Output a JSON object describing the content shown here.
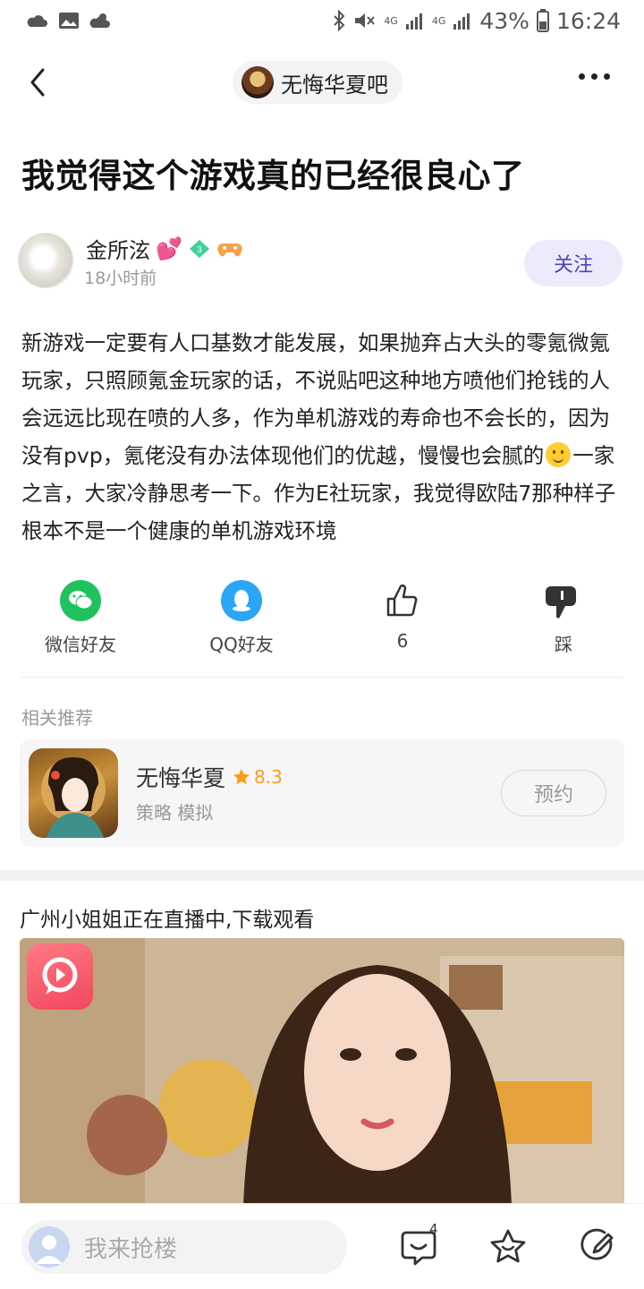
{
  "status_bar": {
    "battery": "43%",
    "time": "16:24",
    "network_1": "4G",
    "network_2": "4G"
  },
  "nav": {
    "forum_name": "无悔华夏吧"
  },
  "post": {
    "title": "我觉得这个游戏真的已经很良心了",
    "author_name": "金所泫",
    "author_heart": "💕",
    "author_level": "3",
    "time_ago": "18小时前",
    "follow_label": "关注",
    "body_part1": "新游戏一定要有人口基数才能发展，如果抛弃占大头的零氪微氪玩家，只照顾氪金玩家的话，不说贴吧这种地方喷他们抢钱的人会远远比现在喷的人多，作为单机游戏的寿命也不会长的，因为没有pvp，氪佬没有办法体现他们的优越，慢慢也会腻的",
    "body_part2": "一家之言，大家冷静思考一下。作为E社玩家，我觉得欧陆7那种样子根本不是一个健康的单机游戏环境"
  },
  "share": {
    "wechat_label": "微信好友",
    "qq_label": "QQ好友",
    "like_count": "6",
    "dislike_label": "踩"
  },
  "recommend": {
    "section_label": "相关推荐",
    "game_name": "无悔华夏",
    "rating": "8.3",
    "tags": "策略 模拟",
    "reserve_label": "预约"
  },
  "ad": {
    "title": "广州小姐姐正在直播中,下载观看"
  },
  "bottom_bar": {
    "comment_placeholder": "我来抢楼",
    "comment_count": "4"
  },
  "colors": {
    "accent": "#4f46b8",
    "follow_bg": "#ecebfb",
    "wechat": "#1fc25c",
    "qq": "#2aa6f4",
    "rating": "#ff9b1a"
  }
}
